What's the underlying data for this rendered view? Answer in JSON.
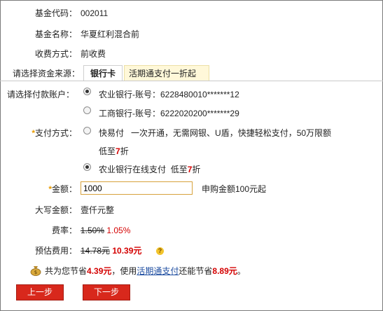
{
  "fund_info": {
    "code_label": "基金代码：",
    "code": "002011",
    "name_label": "基金名称：",
    "name": "华夏红利混合前",
    "fee_mode_label": "收费方式：",
    "fee_mode": "前收费"
  },
  "fund_source": {
    "label": "请选择资金来源：",
    "tabs": [
      {
        "label": "银行卡",
        "selected": true
      },
      {
        "label": "活期通支付一折起",
        "selected": false
      }
    ]
  },
  "payment_account": {
    "label": "请选择付款账户：",
    "options": [
      {
        "label": "农业银行-账号：6228480010*******12",
        "selected": true
      },
      {
        "label": "工商银行-账号：6222020200*******29",
        "selected": false
      }
    ]
  },
  "payment_method": {
    "star": "*",
    "label": "支付方式：",
    "option1_name": "快易付",
    "option1_desc": "一次开通，无需网银、U盾，快捷轻松支付，50万限额",
    "option1_discount_prefix": "低至",
    "option1_discount_value": "7",
    "option1_discount_suffix": "折",
    "option1_selected": false,
    "option2_name": "农业银行在线支付",
    "option2_discount_prefix": "低至",
    "option2_discount_value": "7",
    "option2_discount_suffix": "折",
    "option2_selected": true
  },
  "amount": {
    "star": "*",
    "label": "金额：",
    "value": "1000",
    "hint": "申购金额100元起"
  },
  "uppercase_amount": {
    "label": "大写金额：",
    "value": "壹仟元整"
  },
  "fee_rate": {
    "label": "费率：",
    "original": "1.50%",
    "discounted": "1.05%"
  },
  "estimated_fee": {
    "label": "预估费用：",
    "original": "14.78元",
    "discounted": "10.39元",
    "help_icon": "?"
  },
  "savings": {
    "prefix": "共为您节省",
    "amount": "4.39元",
    "middle": "，使用",
    "link": "活期通支付",
    "middle2": "还能节省",
    "amount2": "8.89元",
    "suffix": "。"
  },
  "buttons": {
    "prev": "上一步",
    "next": "下一步"
  },
  "colors": {
    "accent_red": "#d40000",
    "button_red": "#d8281c",
    "tab_yellow": "#fff8d9",
    "link_blue": "#1f4ea1"
  }
}
